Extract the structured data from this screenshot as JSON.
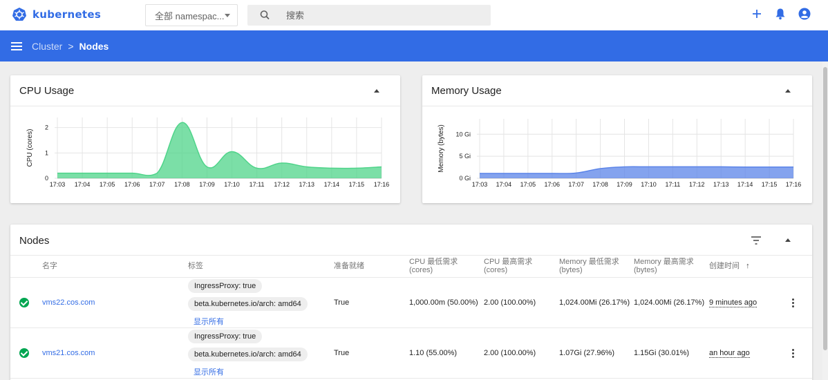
{
  "app": {
    "brand": "kubernetes"
  },
  "topbar": {
    "namespace_selected": "全部 namespac...",
    "search_placeholder": "搜索"
  },
  "breadcrumb": {
    "parent": "Cluster",
    "separator": ">",
    "current": "Nodes"
  },
  "colors": {
    "brand": "#326ce5",
    "cpu": "#4fd48a",
    "memory": "#5b84e8",
    "ready": "#00a651"
  },
  "cpu_card": {
    "title": "CPU Usage",
    "chart_data": {
      "type": "area",
      "ylabel": "CPU (cores)",
      "yticks": [
        "0",
        "1",
        "2"
      ],
      "ylim": [
        0,
        2.4
      ],
      "x": [
        "17:03",
        "17:04",
        "17:05",
        "17:06",
        "17:07",
        "17:08",
        "17:09",
        "17:10",
        "17:11",
        "17:12",
        "17:13",
        "17:14",
        "17:15",
        "17:16"
      ],
      "series": [
        {
          "values": [
            0.2,
            0.2,
            0.2,
            0.2,
            0.2,
            2.2,
            0.45,
            1.05,
            0.4,
            0.6,
            0.45,
            0.4,
            0.4,
            0.45
          ]
        }
      ],
      "grid": true
    }
  },
  "memory_card": {
    "title": "Memory Usage",
    "chart_data": {
      "type": "area",
      "ylabel": "Memory (bytes)",
      "yticks": [
        "0 Gi",
        "5 Gi",
        "10 Gi"
      ],
      "ylim": [
        0,
        13.5
      ],
      "x": [
        "17:03",
        "17:04",
        "17:05",
        "17:06",
        "17:07",
        "17:08",
        "17:09",
        "17:10",
        "17:11",
        "17:12",
        "17:13",
        "17:14",
        "17:15",
        "17:16"
      ],
      "series": [
        {
          "values": [
            1.1,
            1.1,
            1.1,
            1.1,
            1.2,
            2.2,
            2.6,
            2.6,
            2.6,
            2.6,
            2.6,
            2.55,
            2.55,
            2.55
          ]
        }
      ],
      "grid": true
    }
  },
  "nodes": {
    "title": "Nodes",
    "columns": {
      "name": "名字",
      "labels": "标签",
      "ready": "准备就绪",
      "cpu_req_1": "CPU 最低需求",
      "cpu_req_2": "(cores)",
      "cpu_lim_1": "CPU 最高需求",
      "cpu_lim_2": "(cores)",
      "mem_req_1": "Memory 最低需求",
      "mem_req_2": "(bytes)",
      "mem_lim_1": "Memory 最高需求",
      "mem_lim_2": "(bytes)",
      "created": "创建时间",
      "sort_indicator": "↑"
    },
    "rows": [
      {
        "name": "vms22.cos.com",
        "labels": [
          "IngressProxy: true",
          "beta.kubernetes.io/arch: amd64"
        ],
        "show_all": "显示所有",
        "ready": "True",
        "cpu_requests": "1,000.00m (50.00%)",
        "cpu_limits": "2.00 (100.00%)",
        "memory_requests": "1,024.00Mi (26.17%)",
        "memory_limits": "1,024.00Mi (26.17%)",
        "created": "9 minutes ago"
      },
      {
        "name": "vms21.cos.com",
        "labels": [
          "IngressProxy: true",
          "beta.kubernetes.io/arch: amd64"
        ],
        "show_all": "显示所有",
        "ready": "True",
        "cpu_requests": "1.10 (55.00%)",
        "cpu_limits": "2.00 (100.00%)",
        "memory_requests": "1.07Gi (27.96%)",
        "memory_limits": "1.15Gi (30.01%)",
        "created": "an hour ago"
      }
    ]
  }
}
